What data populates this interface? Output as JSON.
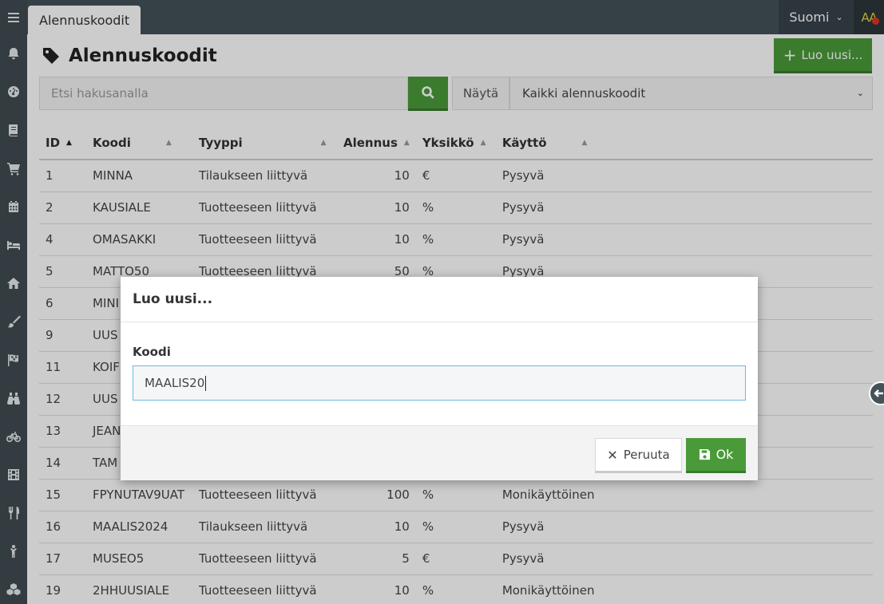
{
  "topbar": {
    "tab_label": "Alennuskoodit",
    "language": "Suomi",
    "user_initials": "AA"
  },
  "page": {
    "title": "Alennuskoodit",
    "new_button": "Luo uusi..."
  },
  "search": {
    "placeholder": "Etsi hakusanalla"
  },
  "filter": {
    "label": "Näytä",
    "selected": "Kaikki alennuskoodit"
  },
  "table": {
    "headers": [
      "ID",
      "Koodi",
      "Tyyppi",
      "Alennus",
      "Yksikkö",
      "Käyttö"
    ],
    "rows": [
      [
        "1",
        "MINNA",
        "Tilaukseen liittyvä",
        "10",
        "€",
        "Pysyvä"
      ],
      [
        "2",
        "KAUSIALE",
        "Tuotteeseen liittyvä",
        "10",
        "%",
        "Pysyvä"
      ],
      [
        "4",
        "OMASAKKI",
        "Tuotteeseen liittyvä",
        "10",
        "%",
        "Pysyvä"
      ],
      [
        "5",
        "MATTO50",
        "Tuotteeseen liittyvä",
        "50",
        "%",
        "Pysyvä"
      ],
      [
        "6",
        "MINI",
        "",
        "",
        "",
        ""
      ],
      [
        "9",
        "UUS",
        "",
        "",
        "",
        ""
      ],
      [
        "11",
        "KOIF",
        "",
        "",
        "",
        ""
      ],
      [
        "12",
        "UUS",
        "",
        "",
        "",
        ""
      ],
      [
        "13",
        "JEAN",
        "",
        "",
        "",
        ""
      ],
      [
        "14",
        "TAM",
        "",
        "",
        "",
        ""
      ],
      [
        "15",
        "FPYNUTAV9UAT",
        "Tuotteeseen liittyvä",
        "100",
        "%",
        "Monikäyttöinen"
      ],
      [
        "16",
        "MAALIS2024",
        "Tilaukseen liittyvä",
        "10",
        "%",
        "Pysyvä"
      ],
      [
        "17",
        "MUSEO5",
        "Tuotteeseen liittyvä",
        "5",
        "€",
        "Pysyvä"
      ],
      [
        "19",
        "2HHUUSIALE",
        "Tuotteeseen liittyvä",
        "10",
        "%",
        "Monikäyttöinen"
      ]
    ]
  },
  "modal": {
    "title": "Luo uusi...",
    "field_label": "Koodi",
    "field_value": "MAALIS20",
    "cancel_label": "Peruuta",
    "ok_label": "Ok"
  },
  "sidebar_icons": [
    "menu-icon",
    "bell-icon",
    "dashboard-icon",
    "book-icon",
    "cart-icon",
    "calendar-icon",
    "bed-icon",
    "home-icon",
    "brush-icon",
    "flag-checkered-icon",
    "binoculars-icon",
    "bicycle-icon",
    "film-icon",
    "utensils-icon",
    "child-icon",
    "cubes-icon"
  ]
}
